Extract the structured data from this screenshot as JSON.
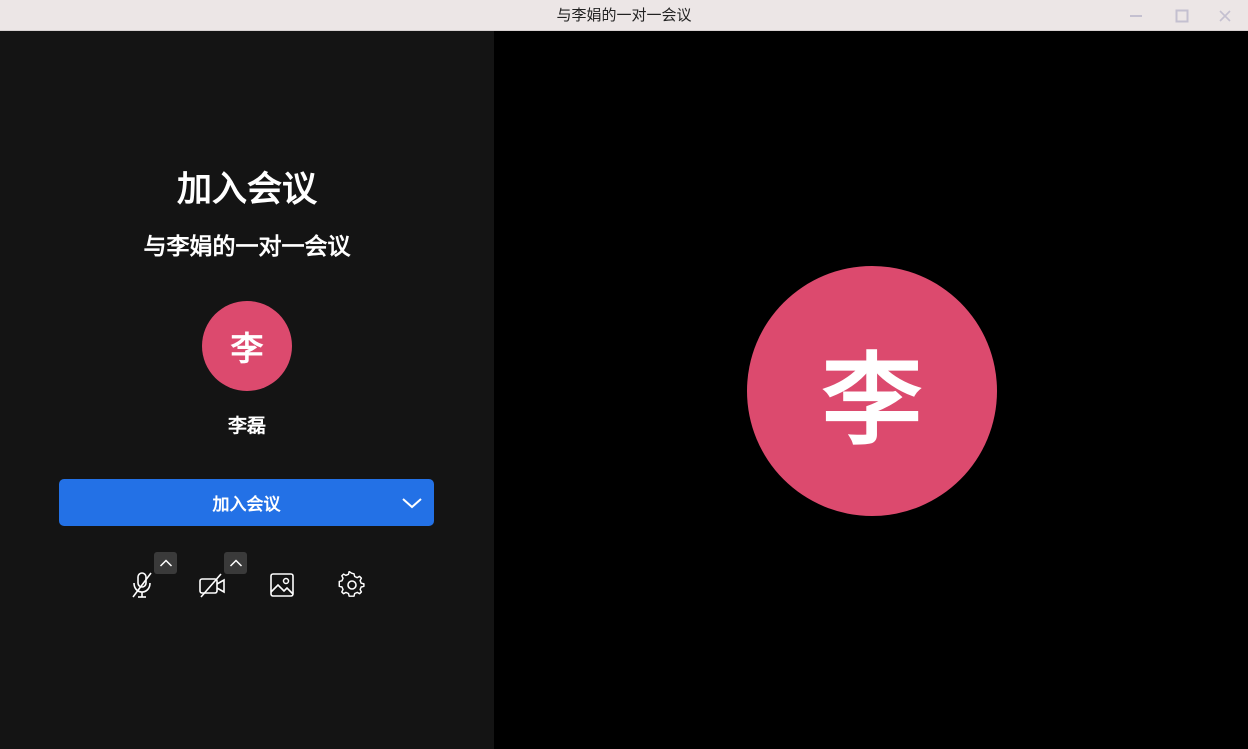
{
  "window": {
    "title": "与李娟的一对一会议"
  },
  "left_panel": {
    "heading": "加入会议",
    "meeting_name": "与李娟的一对一会议",
    "avatar_initial": "李",
    "user_name": "李磊",
    "join_button_label": "加入会议",
    "toolbar": {
      "icons": [
        "microphone-muted-icon",
        "video-off-icon",
        "background-image-icon",
        "settings-gear-icon"
      ]
    }
  },
  "right_panel": {
    "avatar_initial": "李"
  },
  "colors": {
    "accent_blue": "#2371e6",
    "avatar_pink": "#dc4a6e",
    "left_bg": "#141414",
    "right_bg": "#000000",
    "titlebar_bg": "#ece6e6"
  }
}
